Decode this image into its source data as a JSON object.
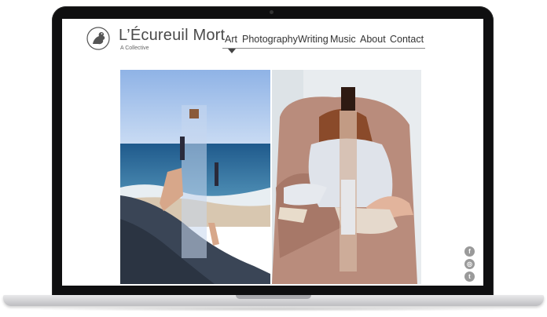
{
  "site": {
    "title": "L’Écureuil Mort",
    "tagline": "A Collective",
    "logo_icon": "squirrel-logo-icon"
  },
  "nav": {
    "items": [
      {
        "label": "Art",
        "active": true
      },
      {
        "label": "Photography",
        "active": false
      },
      {
        "label": "Writing",
        "active": false
      },
      {
        "label": "Music",
        "active": false
      },
      {
        "label": "About",
        "active": false
      },
      {
        "label": "Contact",
        "active": false
      }
    ]
  },
  "gallery": {
    "images": [
      {
        "subject": "beach-collage-photo"
      },
      {
        "subject": "armchair-collage-photo"
      }
    ]
  },
  "social": [
    {
      "icon": "facebook-icon",
      "glyph": "f"
    },
    {
      "icon": "instagram-icon",
      "glyph": "◎"
    },
    {
      "icon": "twitter-icon",
      "glyph": "t"
    }
  ],
  "colors": {
    "laptop_bezel": "#0f0f10",
    "nav_text": "#333333",
    "icon_gray": "#9a9a9a"
  }
}
